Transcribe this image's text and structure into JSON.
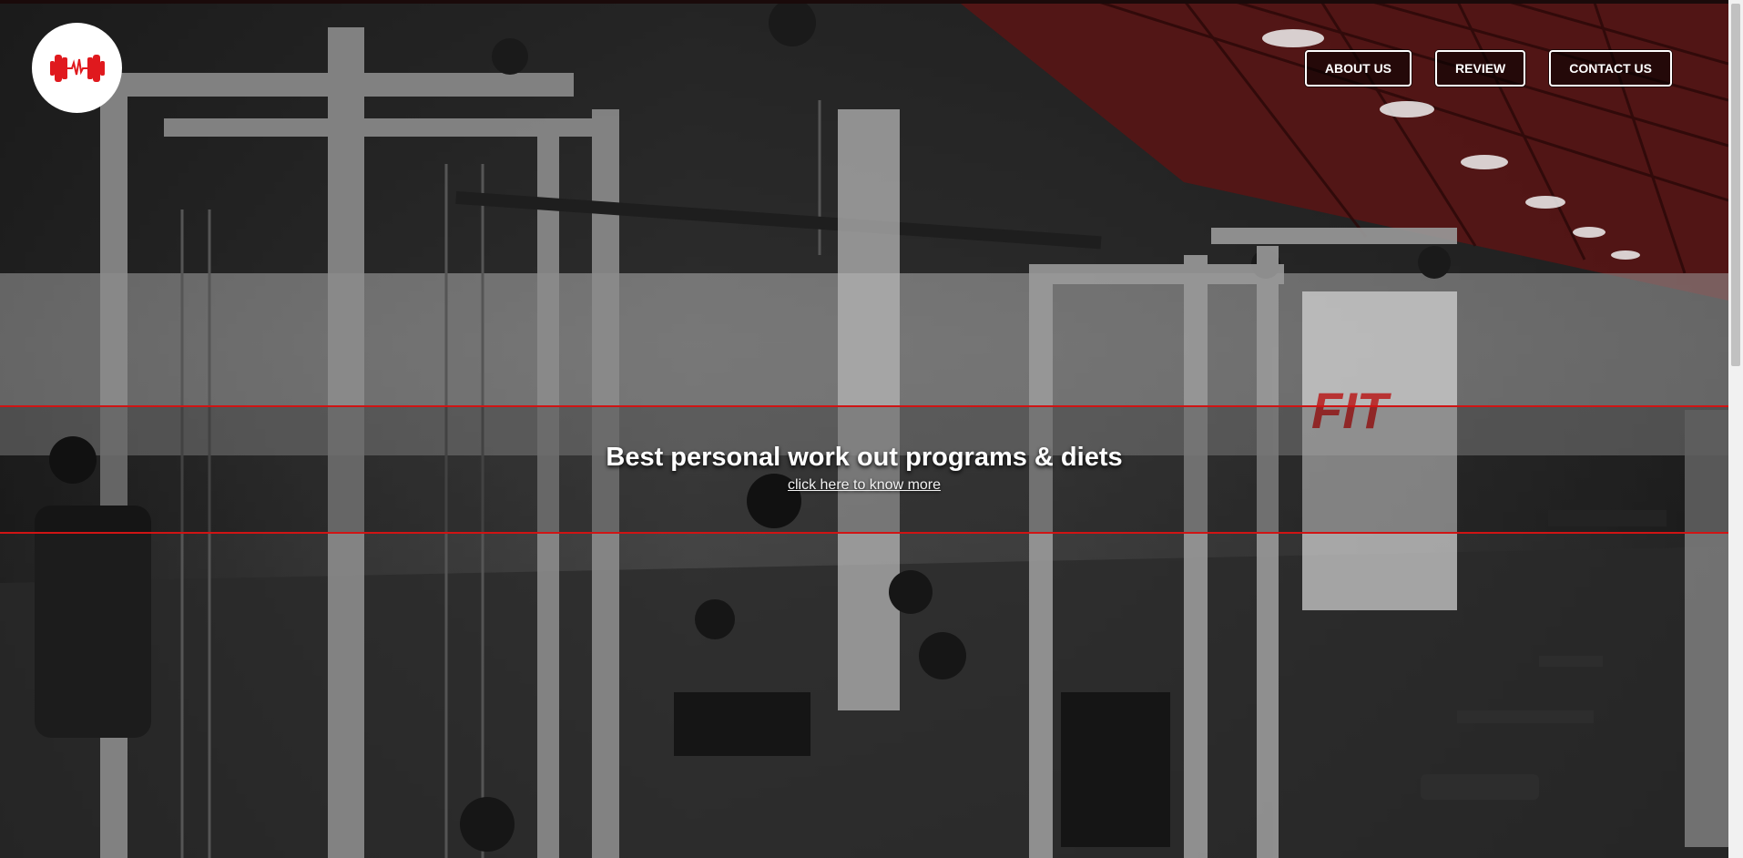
{
  "nav": {
    "items": [
      {
        "label": "ABOUT US"
      },
      {
        "label": "REVIEW"
      },
      {
        "label": "CONTACT US"
      }
    ]
  },
  "hero": {
    "headline": "Best personal work out programs & diets",
    "link_text": "click here to know more"
  },
  "logo": {
    "icon": "dumbbell-heartbeat-icon",
    "color": "#e0191e"
  },
  "colors": {
    "accent": "#d01414",
    "nav_border": "#ffffff"
  }
}
